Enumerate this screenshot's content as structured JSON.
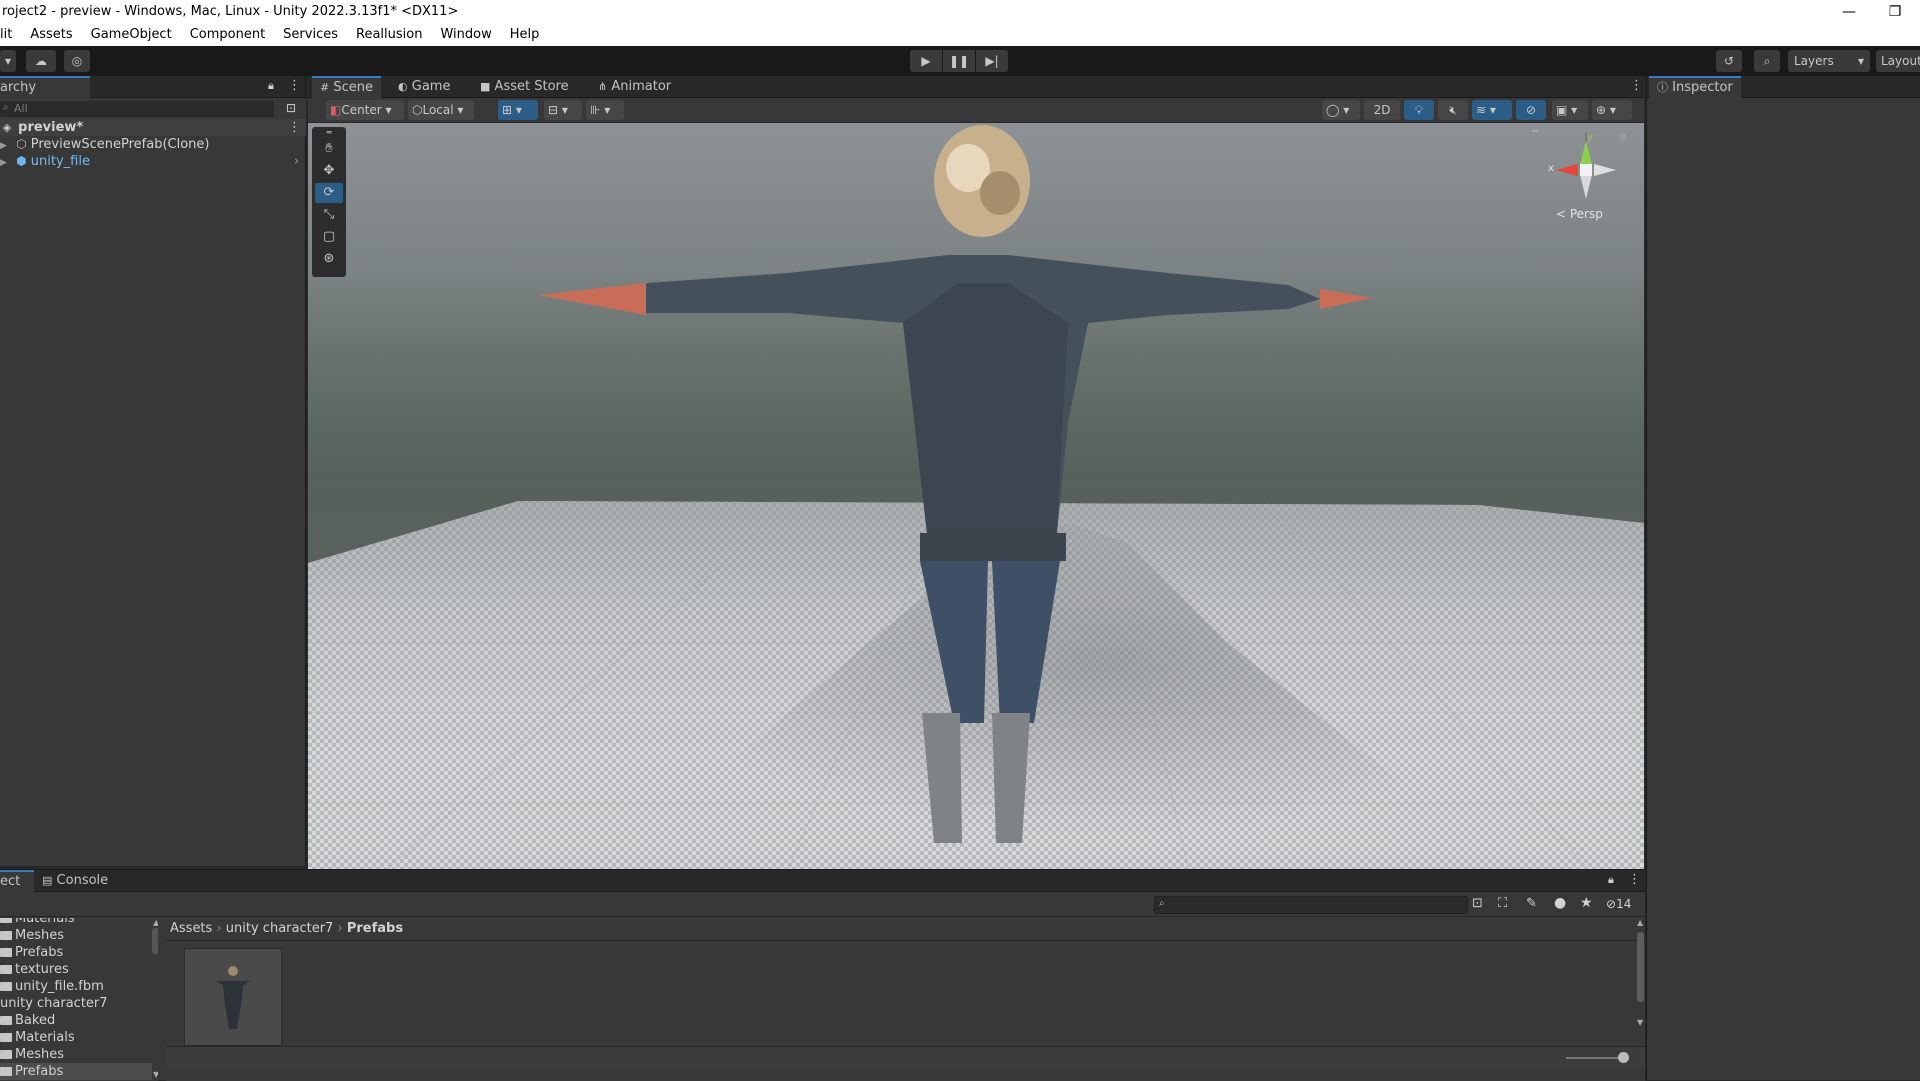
{
  "window": {
    "title": "roject2 - preview - Windows, Mac, Linux - Unity 2022.3.13f1* <DX11>",
    "minimize": "—",
    "restore": "❐"
  },
  "menu": [
    "lit",
    "Assets",
    "GameObject",
    "Component",
    "Services",
    "Reallusion",
    "Window",
    "Help"
  ],
  "toolbar": {
    "layers_label": "Layers",
    "layout_label": "Layout"
  },
  "hierarchy": {
    "tab_label": "archy",
    "search_placeholder": "All",
    "scene_name": "preview*",
    "items": [
      {
        "label": "PreviewScenePrefab(Clone)"
      },
      {
        "label": "unity_file"
      }
    ]
  },
  "scene": {
    "tabs": [
      {
        "label": "Scene"
      },
      {
        "label": "Game"
      },
      {
        "label": "Asset Store"
      },
      {
        "label": "Animator"
      }
    ],
    "pivot_label": "Center",
    "space_label": "Local",
    "mode_2d": "2D",
    "gizmo": {
      "projection": "< Persp",
      "y": "y",
      "x": "x"
    }
  },
  "inspector": {
    "tab_label": "Inspector"
  },
  "project": {
    "tabs": [
      {
        "label": "ect"
      },
      {
        "label": "Console"
      }
    ],
    "breadcrumb": [
      "Assets",
      "unity character7",
      "Prefabs"
    ],
    "hidden_count": "14",
    "folders": [
      {
        "label": "Materials",
        "indent": 1
      },
      {
        "label": "Meshes",
        "indent": 1
      },
      {
        "label": "Prefabs",
        "indent": 1
      },
      {
        "label": "textures",
        "indent": 1
      },
      {
        "label": "unity_file.fbm",
        "indent": 1
      },
      {
        "label": "unity character7",
        "indent": 0
      },
      {
        "label": "Baked",
        "indent": 1
      },
      {
        "label": "Materials",
        "indent": 1
      },
      {
        "label": "Meshes",
        "indent": 1
      },
      {
        "label": "Prefabs",
        "indent": 1
      }
    ]
  },
  "colors": {
    "accent": "#3a79bb",
    "selected": "#2c5d87",
    "panel": "#383838",
    "dark": "#282828"
  }
}
